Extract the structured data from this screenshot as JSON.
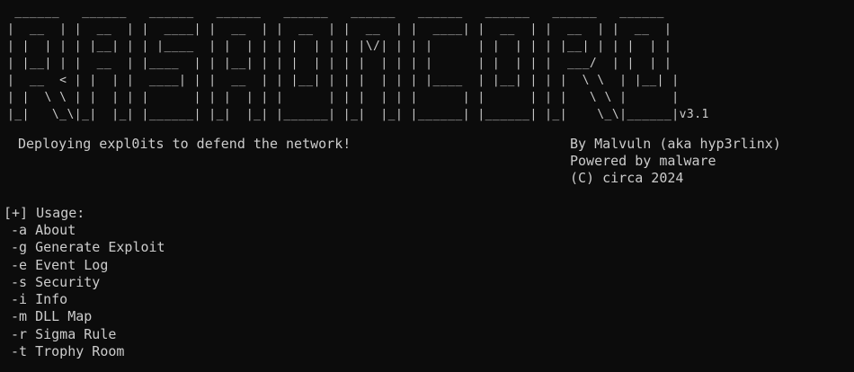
{
  "banner": {
    "art": " ______   ______   ______   ______   ______   ______   ______   ______   ______   ______\n|  __  | |  __  | |  ____| |  __  | |  __  | |  __  | |  ____| |  __  | |  __  | |  __  |\n| |  | | | |__| | | |____  | |  | | | |  | | | |\\/| | | |      | |  | | | |__| | | |  | |\n| |__| | |  __  | |____  | | |__| | | |  | | | |  | | | |      | |  | | |  ___/  | |  | |\n|  __  < | |  | |  ____| | |  __  | | |__| | | |  | | | |____  | |__| | | |  \\ \\  | |__| |\n| |  \\ \\ | |  | | |      | | |  | | |      | | |  | | |      | |      | | |   \\ \\ |      |\n|_|   \\_\\|_|  |_| |______| |_|  |_| |______| |_|  |_| |______| |______| |_|    \\_\\|______|v3.1"
  },
  "tagline": "Deploying expl0its to defend the network!",
  "author": "By Malvuln (aka hyp3rlinx)",
  "powered_by": "Powered by malware",
  "copyright": "(C) circa 2024",
  "usage": {
    "header": "[+] Usage:",
    "items": [
      {
        "flag": "-a",
        "label": "About"
      },
      {
        "flag": "-g",
        "label": "Generate Exploit"
      },
      {
        "flag": "-e",
        "label": "Event Log"
      },
      {
        "flag": "-s",
        "label": "Security"
      },
      {
        "flag": "-i",
        "label": "Info"
      },
      {
        "flag": "-m",
        "label": "DLL Map"
      },
      {
        "flag": "-r",
        "label": "Sigma Rule"
      },
      {
        "flag": "-t",
        "label": "Trophy Room"
      }
    ]
  },
  "colors": {
    "background": "#0c0c0c",
    "foreground": "#cccccc"
  }
}
